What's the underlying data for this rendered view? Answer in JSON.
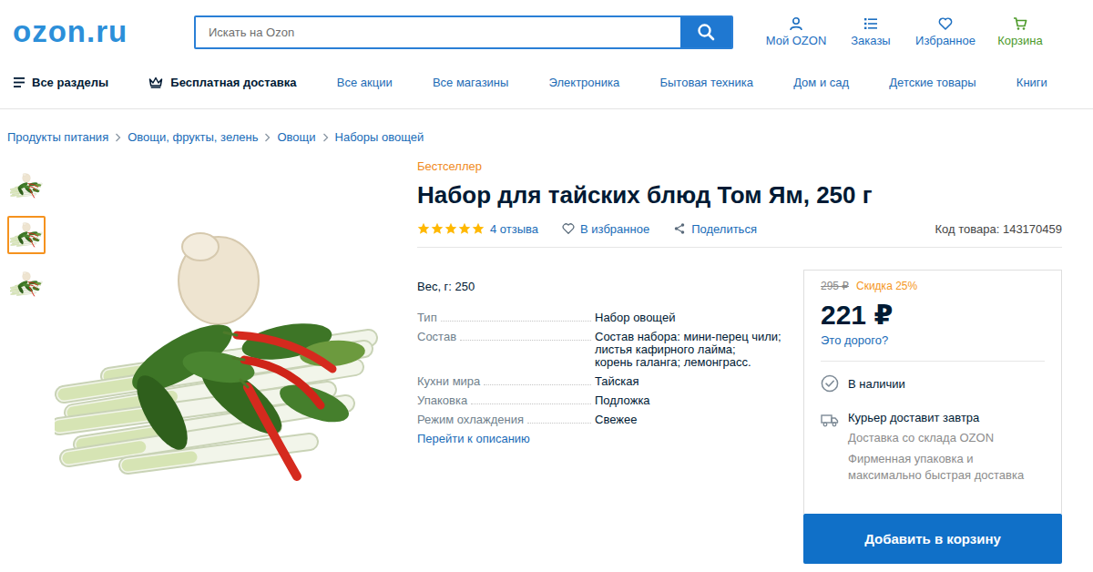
{
  "header": {
    "logo": "ozon.ru",
    "search": {
      "placeholder": "Искать на Ozon"
    },
    "actions": [
      {
        "label": "Мой OZON",
        "color": "#1d6fc1"
      },
      {
        "label": "Заказы",
        "color": "#1d6fc1"
      },
      {
        "label": "Избранное",
        "color": "#1d6fc1"
      },
      {
        "label": "Корзина",
        "color": "#4d9a2a"
      }
    ]
  },
  "nav": {
    "primary": [
      {
        "label": "Все разделы"
      },
      {
        "label": "Бесплатная доставка"
      }
    ],
    "links": [
      {
        "label": "Все акции"
      },
      {
        "label": "Все магазины"
      },
      {
        "label": "Электроника"
      },
      {
        "label": "Бытовая техника"
      },
      {
        "label": "Дом и сад"
      },
      {
        "label": "Детские товары"
      },
      {
        "label": "Книги"
      }
    ]
  },
  "breadcrumbs": [
    "Продукты питания",
    "Овощи, фрукты, зелень",
    "Овощи",
    "Наборы овощей"
  ],
  "gallery": {
    "thumbnails": [
      {
        "selected": false
      },
      {
        "selected": true
      },
      {
        "selected": false
      }
    ]
  },
  "product": {
    "badge": "Бестселлер",
    "title": "Набор для тайских блюд Том Ям, 250 г",
    "stars": 5,
    "reviews": "4 отзыва",
    "favorite": "В избранное",
    "share": "Поделиться",
    "code": "Код товара: 143170459",
    "weight": "Вес, г: 250",
    "specs": [
      {
        "label": "Тип",
        "lines": [
          "Набор овощей"
        ]
      },
      {
        "label": "Состав",
        "lines": [
          "Состав набора: мини-перец чили;",
          "листья кафирного лайма;",
          "корень галанга; лемонграсс."
        ]
      },
      {
        "label": "Кухни мира",
        "lines": [
          "Тайская"
        ]
      },
      {
        "label": "Упаковка",
        "lines": [
          "Подложка"
        ]
      },
      {
        "label": "Режим охлаждения",
        "lines": [
          "Свежее"
        ]
      }
    ],
    "description_link": "Перейти к описанию"
  },
  "offer": {
    "old_price": "295 ₽",
    "discount": "Скидка 25%",
    "price": "221 ₽",
    "too_expensive": "Это дорого?",
    "availability": "В наличии",
    "delivery": "Курьер доставит завтра",
    "warehouse": "Доставка со склада OZON",
    "packaging": "Фирменная упаковка и максимально быстрая доставка",
    "button": "Добавить в корзину"
  }
}
